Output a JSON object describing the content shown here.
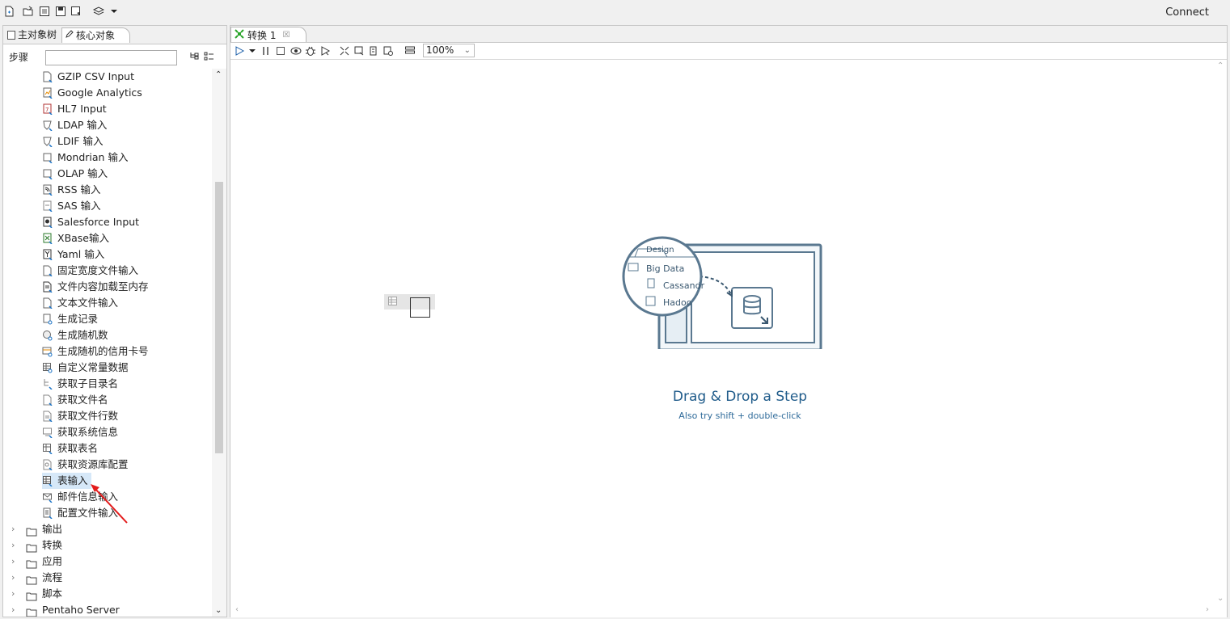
{
  "toolbar": {
    "connect_label": "Connect",
    "icons": [
      "new-file-icon",
      "open-file-icon",
      "explore-repo-icon",
      "save-icon",
      "save-as-icon",
      "perspective-icon",
      "dropdown-caret-icon"
    ]
  },
  "left_panel": {
    "tabs": [
      {
        "label": "主对象树",
        "active": false
      },
      {
        "label": "核心对象",
        "active": true
      }
    ],
    "search_label": "步骤",
    "search_value": "",
    "steps": [
      {
        "label": "GZIP CSV Input"
      },
      {
        "label": "Google Analytics"
      },
      {
        "label": "HL7 Input"
      },
      {
        "label": "LDAP 输入"
      },
      {
        "label": "LDIF 输入"
      },
      {
        "label": "Mondrian 输入"
      },
      {
        "label": "OLAP 输入"
      },
      {
        "label": "RSS 输入"
      },
      {
        "label": "SAS 输入"
      },
      {
        "label": "Salesforce Input"
      },
      {
        "label": "XBase输入"
      },
      {
        "label": "Yaml 输入"
      },
      {
        "label": "固定宽度文件输入"
      },
      {
        "label": "文件内容加载至内存"
      },
      {
        "label": "文本文件输入"
      },
      {
        "label": "生成记录"
      },
      {
        "label": "生成随机数"
      },
      {
        "label": "生成随机的信用卡号"
      },
      {
        "label": "自定义常量数据"
      },
      {
        "label": "获取子目录名"
      },
      {
        "label": "获取文件名"
      },
      {
        "label": "获取文件行数"
      },
      {
        "label": "获取系统信息"
      },
      {
        "label": "获取表名"
      },
      {
        "label": "获取资源库配置"
      },
      {
        "label": "表输入",
        "selected": true
      },
      {
        "label": "邮件信息输入"
      },
      {
        "label": "配置文件输入"
      }
    ],
    "folders": [
      {
        "label": "输出"
      },
      {
        "label": "转换"
      },
      {
        "label": "应用"
      },
      {
        "label": "流程"
      },
      {
        "label": "脚本"
      },
      {
        "label": "Pentaho Server"
      }
    ]
  },
  "editor": {
    "tab_label": "转换 1",
    "tab_close": "☒",
    "zoom": "100%",
    "illustration": {
      "design_tab": "Design",
      "folder_label": "Big Data",
      "child_1": "Cassandr",
      "child_2": "Hadoo"
    },
    "drag_title": "Drag & Drop a Step",
    "drag_hint": "Also try shift + double-click"
  },
  "colors": {
    "accent_blue": "#1f5b8a",
    "annotation_red": "#e31b1b",
    "selected_bg": "#d6e8f8"
  }
}
